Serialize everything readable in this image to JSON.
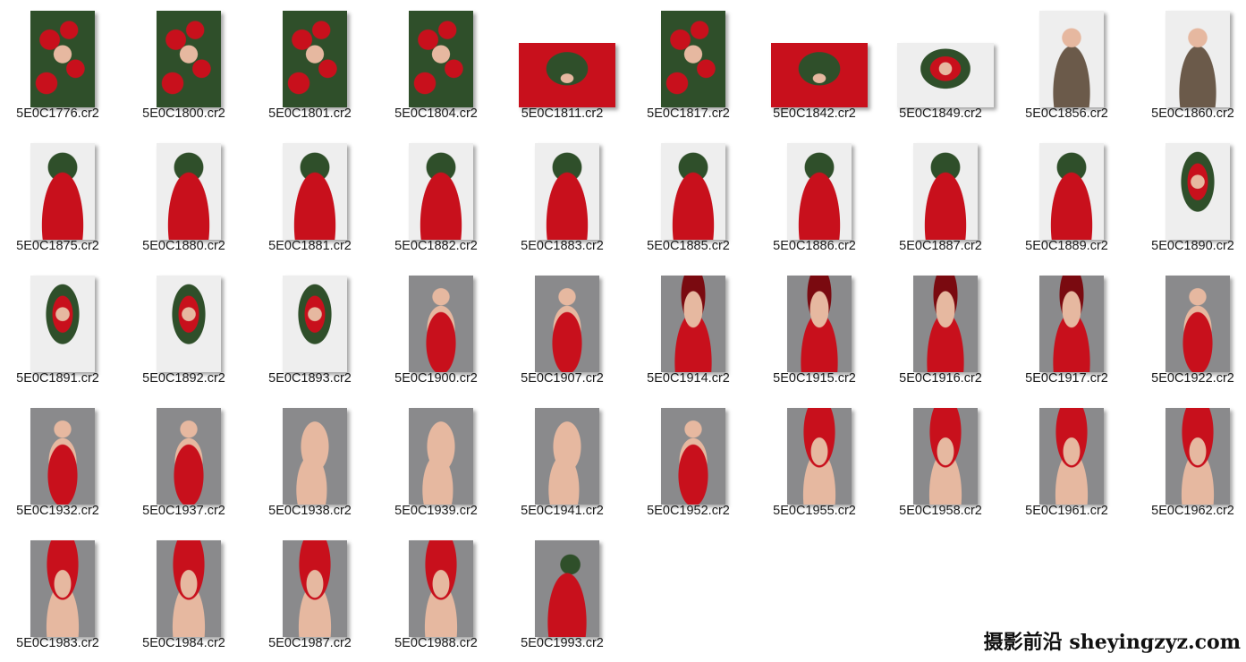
{
  "colors": {
    "red": "#c8101c",
    "dark_red": "#7a0a10",
    "green": "#2f4f2a",
    "gray_bg": "#8a8a8c",
    "white_bg": "#eeeeee",
    "skin": "#e6b8a0",
    "sequin": "#6b5a4a"
  },
  "files": [
    {
      "name": "5E0C1776.cr2",
      "orient": "portrait",
      "style": "wreath-closeup"
    },
    {
      "name": "5E0C1800.cr2",
      "orient": "portrait",
      "style": "wreath"
    },
    {
      "name": "5E0C1801.cr2",
      "orient": "portrait",
      "style": "wreath"
    },
    {
      "name": "5E0C1804.cr2",
      "orient": "portrait",
      "style": "wreath"
    },
    {
      "name": "5E0C1811.cr2",
      "orient": "landscape",
      "style": "wreath-red"
    },
    {
      "name": "5E0C1817.cr2",
      "orient": "portrait",
      "style": "wreath"
    },
    {
      "name": "5E0C1842.cr2",
      "orient": "landscape",
      "style": "wreath-red"
    },
    {
      "name": "5E0C1849.cr2",
      "orient": "landscape",
      "style": "wreath-white"
    },
    {
      "name": "5E0C1856.cr2",
      "orient": "portrait",
      "style": "sequin"
    },
    {
      "name": "5E0C1860.cr2",
      "orient": "portrait",
      "style": "sequin"
    },
    {
      "name": "5E0C1875.cr2",
      "orient": "portrait",
      "style": "gown-white"
    },
    {
      "name": "5E0C1880.cr2",
      "orient": "portrait",
      "style": "gown-white"
    },
    {
      "name": "5E0C1881.cr2",
      "orient": "portrait",
      "style": "gown-white"
    },
    {
      "name": "5E0C1882.cr2",
      "orient": "portrait",
      "style": "gown-white"
    },
    {
      "name": "5E0C1883.cr2",
      "orient": "portrait",
      "style": "gown-white"
    },
    {
      "name": "5E0C1885.cr2",
      "orient": "portrait",
      "style": "gown-white"
    },
    {
      "name": "5E0C1886.cr2",
      "orient": "portrait",
      "style": "gown-white"
    },
    {
      "name": "5E0C1887.cr2",
      "orient": "portrait",
      "style": "gown-white"
    },
    {
      "name": "5E0C1889.cr2",
      "orient": "portrait",
      "style": "gown-white"
    },
    {
      "name": "5E0C1890.cr2",
      "orient": "portrait",
      "style": "wreath-white"
    },
    {
      "name": "5E0C1891.cr2",
      "orient": "portrait",
      "style": "wreath-white"
    },
    {
      "name": "5E0C1892.cr2",
      "orient": "portrait",
      "style": "wreath-white"
    },
    {
      "name": "5E0C1893.cr2",
      "orient": "portrait",
      "style": "wreath-white"
    },
    {
      "name": "5E0C1900.cr2",
      "orient": "portrait",
      "style": "gray-flowers"
    },
    {
      "name": "5E0C1907.cr2",
      "orient": "portrait",
      "style": "gray-flowers"
    },
    {
      "name": "5E0C1914.cr2",
      "orient": "portrait",
      "style": "gray-face"
    },
    {
      "name": "5E0C1915.cr2",
      "orient": "portrait",
      "style": "gray-face"
    },
    {
      "name": "5E0C1916.cr2",
      "orient": "portrait",
      "style": "gray-face"
    },
    {
      "name": "5E0C1917.cr2",
      "orient": "portrait",
      "style": "gray-face"
    },
    {
      "name": "5E0C1922.cr2",
      "orient": "portrait",
      "style": "gray-flowers"
    },
    {
      "name": "5E0C1932.cr2",
      "orient": "portrait",
      "style": "gray-flowers"
    },
    {
      "name": "5E0C1937.cr2",
      "orient": "portrait",
      "style": "gray-flowers"
    },
    {
      "name": "5E0C1938.cr2",
      "orient": "portrait",
      "style": "gray-shoulder"
    },
    {
      "name": "5E0C1939.cr2",
      "orient": "portrait",
      "style": "gray-shoulder"
    },
    {
      "name": "5E0C1941.cr2",
      "orient": "portrait",
      "style": "gray-shoulder"
    },
    {
      "name": "5E0C1952.cr2",
      "orient": "portrait",
      "style": "gray-flowers"
    },
    {
      "name": "5E0C1955.cr2",
      "orient": "portrait",
      "style": "flower-hat"
    },
    {
      "name": "5E0C1958.cr2",
      "orient": "portrait",
      "style": "flower-hat"
    },
    {
      "name": "5E0C1961.cr2",
      "orient": "portrait",
      "style": "flower-hat"
    },
    {
      "name": "5E0C1962.cr2",
      "orient": "portrait",
      "style": "flower-hat"
    },
    {
      "name": "5E0C1983.cr2",
      "orient": "portrait",
      "style": "flower-hat"
    },
    {
      "name": "5E0C1984.cr2",
      "orient": "portrait",
      "style": "flower-hat"
    },
    {
      "name": "5E0C1987.cr2",
      "orient": "portrait",
      "style": "flower-hat"
    },
    {
      "name": "5E0C1988.cr2",
      "orient": "portrait",
      "style": "flower-hat"
    },
    {
      "name": "5E0C1993.cr2",
      "orient": "portrait",
      "style": "gown-gray"
    }
  ],
  "watermark": "摄影前沿 sheyingzyz.com"
}
